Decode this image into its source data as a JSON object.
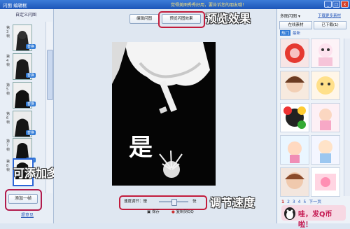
{
  "window": {
    "title": "闪图 编辑框",
    "marquee": "觉得美图秀秀好用，要告诉您的朋友哦！",
    "buttons": [
      "_",
      "□",
      "x"
    ]
  },
  "left_panel": {
    "header": "自定义闪图",
    "frames": [
      {
        "label": "第3帧",
        "replace": "替换"
      },
      {
        "label": "第4帧",
        "replace": "替换"
      },
      {
        "label": "第5帧",
        "replace": "替换"
      },
      {
        "label": "第6帧",
        "replace": "替换"
      },
      {
        "label": "第7帧",
        "replace": "替换"
      },
      {
        "label": "第8帧",
        "replace": "替换"
      }
    ],
    "add_frame_button": "添加一帧",
    "feedback_link": "提意见"
  },
  "toolbar": {
    "edit_tab": "编辑闪图",
    "preview_tab": "预览闪图效果"
  },
  "canvas": {
    "overlay_text": "是"
  },
  "speed_control": {
    "label": "速度调节：慢",
    "fast_label": "快",
    "value_percent": 52
  },
  "bottom_buttons": {
    "save": "保存",
    "copy_to_qq": "复制到QQ"
  },
  "callouts": {
    "preview": "预览效果",
    "add_frames": "可添加多帧",
    "speed": "调节速度"
  },
  "right_panel": {
    "category": "多图闪图",
    "download_link": "下载更多素材",
    "tabs": [
      "在线素材",
      "已下载(1)"
    ],
    "filter_tabs": [
      "热门",
      "最新"
    ],
    "pager": {
      "pages": [
        "1",
        "2",
        "3",
        "4",
        "5"
      ],
      "current": "1",
      "next": "下一页"
    },
    "banner_text": "哇，发Q币啦！"
  },
  "colors": {
    "titlebar": "#1c55b8",
    "highlight_border": "#c21c3c",
    "link": "#2757b8"
  }
}
